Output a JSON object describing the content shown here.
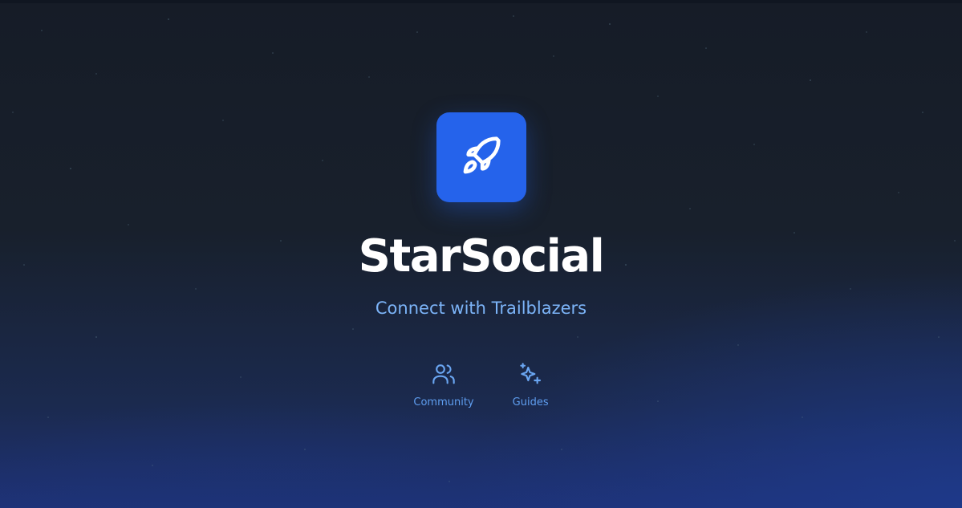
{
  "app": {
    "name": "StarSocial",
    "tagline": "Connect with Trailblazers",
    "icon": "rocket-icon"
  },
  "links": [
    {
      "label": "Community",
      "icon": "users-icon"
    },
    {
      "label": "Guides",
      "icon": "sparkles-icon"
    }
  ],
  "colors": {
    "accent": "#2563eb",
    "tagline": "#7cb4f8",
    "link": "#5f9ef0",
    "title": "#ffffff"
  }
}
